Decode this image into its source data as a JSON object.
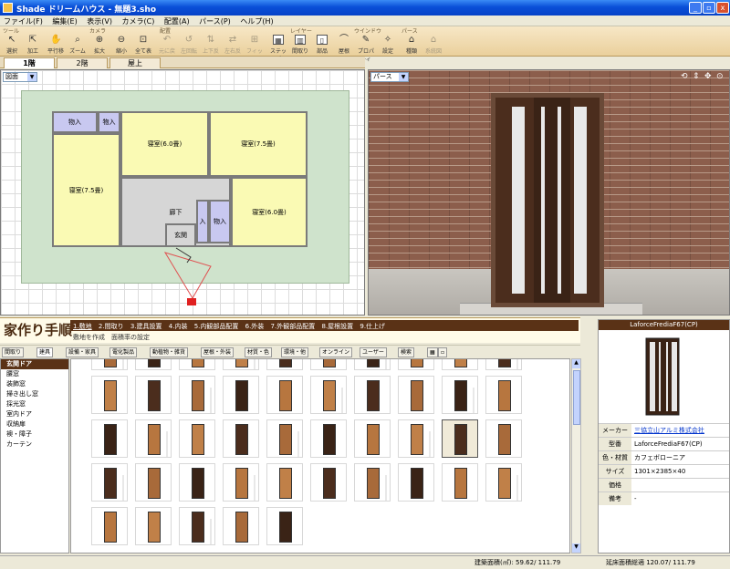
{
  "window": {
    "title": "Shade ドリームハウス - 無題3.sho"
  },
  "menu": [
    "ファイル(F)",
    "編集(E)",
    "表示(V)",
    "カメラ(C)",
    "配置(A)",
    "パース(P)",
    "ヘルプ(H)"
  ],
  "toolbar": {
    "groups": [
      "ツール",
      "カメラ",
      "配置",
      "レイヤー",
      "ウインドウ",
      "パース"
    ],
    "buttons": [
      "選択",
      "加工",
      "平行移動",
      "ズーム",
      "拡大",
      "縮小",
      "全て表示",
      "元に戻す",
      "左回転",
      "上下反転",
      "左右反転",
      "フィット",
      "ステップ",
      "間取り",
      "部品",
      "屋根",
      "プロパティ",
      "設定",
      "種類",
      "系統図"
    ]
  },
  "floors": [
    "1階",
    "2階",
    "屋上"
  ],
  "plan": {
    "view_select": "図面",
    "rooms": [
      "物入",
      "物入",
      "寝室(6.0畳)",
      "寝室(7.5畳)",
      "寝室(7.5畳)",
      "廊下",
      "入",
      "物入",
      "寝室(6.0畳)",
      "玄関"
    ]
  },
  "view3d": {
    "mode_select": "パース"
  },
  "howto": {
    "title": "家作り手順",
    "steps": [
      "1.敷地",
      "2.間取り",
      "3.建具設置",
      "4.内装",
      "5.内観部品配置",
      "6.外装",
      "7.外観部品配置",
      "8.屋根設置",
      "9.仕上げ"
    ],
    "subs": [
      "敷地を作成",
      "面積率の設定"
    ]
  },
  "categories_tabs": [
    "間取り",
    "建具",
    "設備・家具",
    "電化製品",
    "動植物・雑貨",
    "屋根・外装",
    "材質・色",
    "環境・他",
    "オンライン",
    "ユーザー",
    "検索"
  ],
  "category_list": [
    "玄関ドア",
    "腰窓",
    "装飾窓",
    "掃き出し窓",
    "採光窓",
    "室内ドア",
    "収納扉",
    "襖・障子",
    "カーテン"
  ],
  "detail": {
    "title": "LaforceFrediaF67(CP)",
    "rows": [
      {
        "k": "メーカー",
        "v": "三協立山アルミ株式会社"
      },
      {
        "k": "型番",
        "v": "LaforceFrediaF67(CP)"
      },
      {
        "k": "色・材質",
        "v": "カフェボローニア"
      },
      {
        "k": "サイズ",
        "v": "1301×2385×40"
      },
      {
        "k": "価格",
        "v": ""
      },
      {
        "k": "備考",
        "v": "-"
      }
    ]
  },
  "status": {
    "area1": "建築面積(㎡): 59.62/ 111.79",
    "area2": "延床面積総適 120.07/ 111.79"
  }
}
